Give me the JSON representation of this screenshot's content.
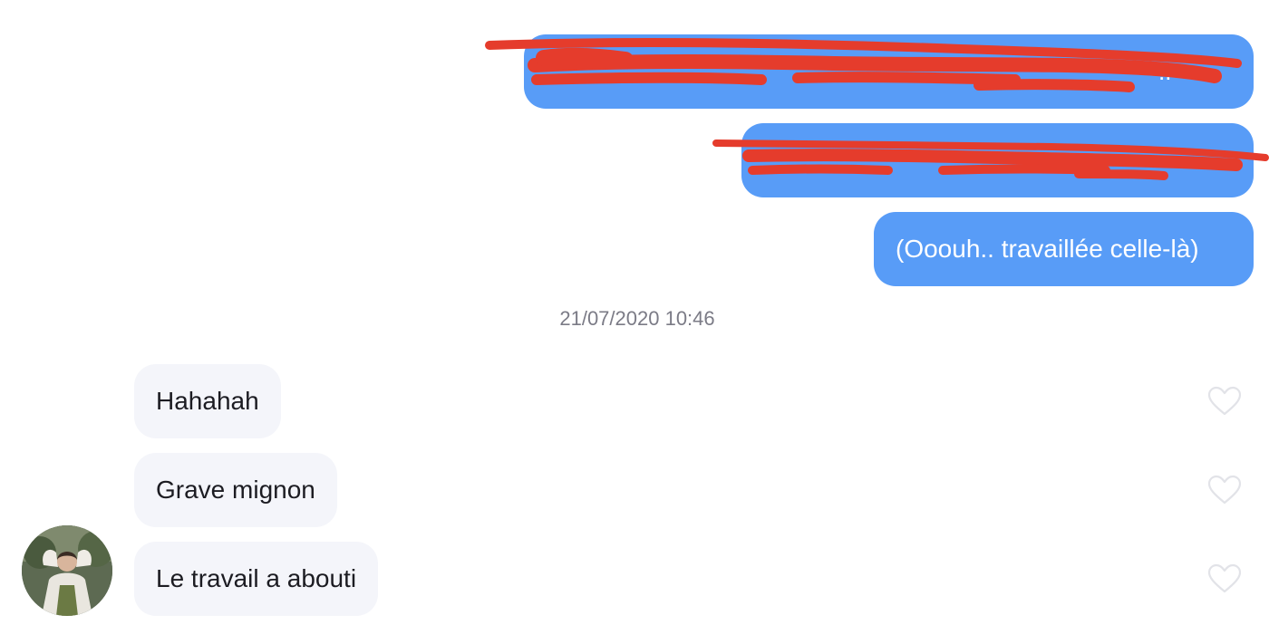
{
  "conversation": {
    "sent_messages": [
      {
        "text": "",
        "redacted": true
      },
      {
        "text": "",
        "redacted": true
      },
      {
        "text": "(Ooouh.. travaillée celle-là)",
        "redacted": false
      }
    ],
    "timestamp": "21/07/2020 10:46",
    "received_messages": [
      {
        "text": "Hahahah",
        "liked": false
      },
      {
        "text": "Grave mignon",
        "liked": false
      },
      {
        "text": "Le travail a abouti",
        "liked": false
      }
    ],
    "colors": {
      "sent_bubble": "#589cf7",
      "received_bubble": "#f4f5fa",
      "redaction_scribble": "#e53c2c",
      "timestamp_text": "#7b7b86",
      "like_icon_stroke": "#e2e3e8"
    },
    "icons": {
      "like": "heart-outline-icon",
      "avatar": "contact-avatar"
    }
  }
}
